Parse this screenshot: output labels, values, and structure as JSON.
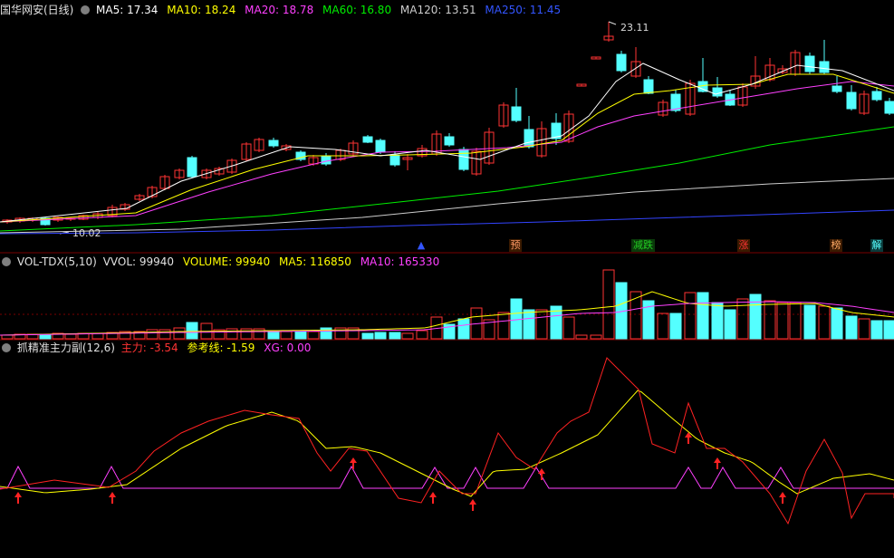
{
  "main_legend": {
    "title": "国华网安(日线)",
    "ma5": "MA5: 17.34",
    "ma10": "MA10: 18.24",
    "ma20": "MA20: 18.78",
    "ma60": "MA60: 16.80",
    "ma120": "MA120: 13.51",
    "ma250": "MA250: 11.45"
  },
  "main_chart": {
    "high_label": "23.11",
    "low_label": "10.02"
  },
  "signals": [
    {
      "label": "▲",
      "color": "#3355ff"
    },
    {
      "label": "预",
      "color": "#ff9966"
    },
    {
      "label": "减跌",
      "color": "#22cc22"
    },
    {
      "label": "涨",
      "color": "#ff3333"
    },
    {
      "label": "榜",
      "color": "#ffaa66"
    },
    {
      "label": "解",
      "color": "#55ffff"
    }
  ],
  "vol_legend": {
    "name": "VOL-TDX(5,10)",
    "vvol": "VVOL: 99940",
    "volume": "VOLUME: 99940",
    "ma5": "MA5: 116850",
    "ma10": "MA10: 165330"
  },
  "ind_legend": {
    "name": "抓精准主力副(12,6)",
    "main": "主力: -3.54",
    "ref": "参考线: -1.59",
    "xg": "XG: 0.00"
  },
  "colors": {
    "up": "#ff3333",
    "down": "#54ffff",
    "ma5": "#ffffff",
    "ma10": "#ffff00",
    "ma20": "#ff40ff",
    "ma60": "#00ee00",
    "ma120": "#cccccc",
    "ma250": "#3344ff",
    "grid": "#7a0000"
  },
  "icons": [
    "toggle-icon",
    "arrow-up-icon"
  ]
}
